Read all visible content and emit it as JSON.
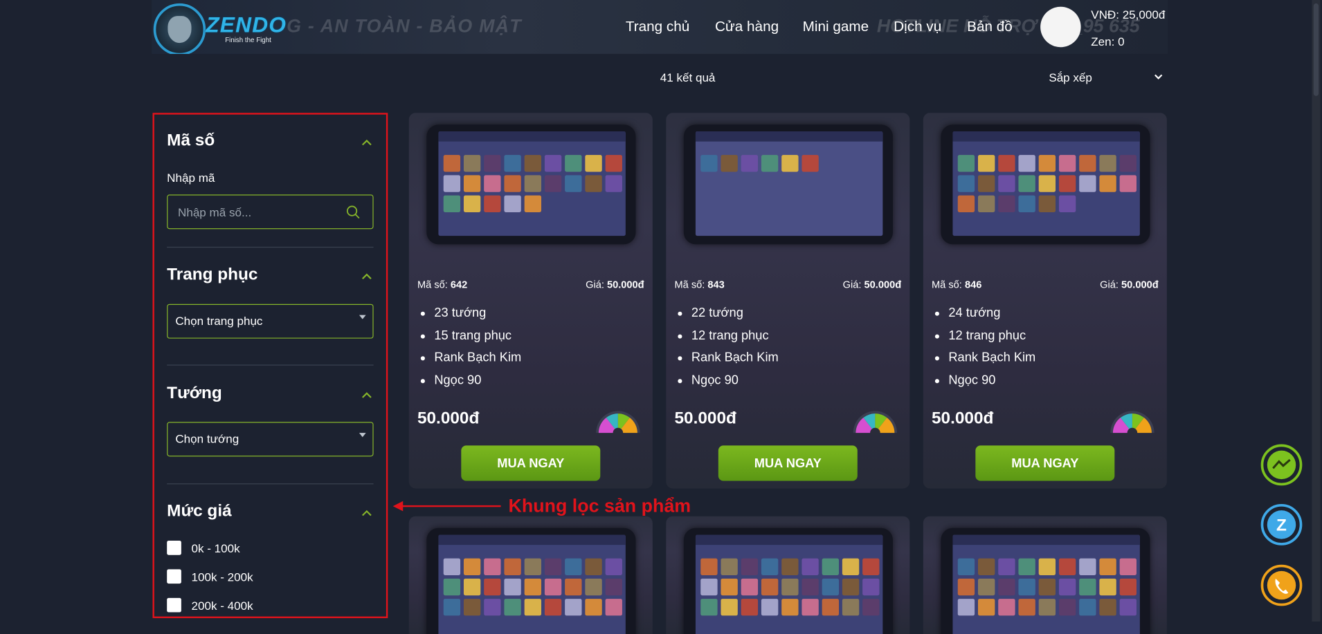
{
  "header": {
    "logo_text": "ZENDO",
    "logo_sub": "Finish the Fight",
    "banner_text": "G - AN TOÀN - BẢO MẬT",
    "banner_text2": "HOTLINE HỖ TRỢ 03__95 635",
    "nav": [
      "Trang chủ",
      "Cửa hàng",
      "Mini game",
      "Dịch vụ",
      "Bản đồ"
    ],
    "balance": "VNĐ: 25,000đ",
    "zen": "Zen: 0"
  },
  "toolbar": {
    "result_count": "41 kết quả",
    "sort_label": "Sắp xếp"
  },
  "sidebar": {
    "code_title": "Mã số",
    "code_label": "Nhập mã",
    "code_placeholder": "Nhập mã số...",
    "outfit_title": "Trang phục",
    "outfit_select": "Chọn trang phục",
    "hero_title": "Tướng",
    "hero_select": "Chọn tướng",
    "price_title": "Mức giá",
    "price_ranges": [
      "0k - 100k",
      "100k - 200k",
      "200k - 400k"
    ]
  },
  "annotation": {
    "text": "Khung lọc sản phẩm",
    "color": "#e0131b"
  },
  "cards": [
    {
      "code_label": "Mã số:",
      "code": "642",
      "price_label": "Giá:",
      "price_small": "50.000đ",
      "features": [
        "23 tướng",
        "15 trang phục",
        "Rank Bạch Kim",
        "Ngọc 90"
      ],
      "price_big": "50.000đ",
      "buy_label": "MUA NGAY"
    },
    {
      "code_label": "Mã số:",
      "code": "843",
      "price_label": "Giá:",
      "price_small": "50.000đ",
      "features": [
        "22 tướng",
        "12 trang phục",
        "Rank Bạch Kim",
        "Ngọc 90"
      ],
      "price_big": "50.000đ",
      "buy_label": "MUA NGAY"
    },
    {
      "code_label": "Mã số:",
      "code": "846",
      "price_label": "Giá:",
      "price_small": "50.000đ",
      "features": [
        "24 tướng",
        "12 trang phục",
        "Rank Bạch Kim",
        "Ngọc 90"
      ],
      "price_big": "50.000đ",
      "buy_label": "MUA NGAY"
    }
  ],
  "float_buttons": [
    "messenger-icon",
    "zalo-icon",
    "phone-icon"
  ],
  "colors": {
    "accent_green": "#7cb81f",
    "background": "#1c2230",
    "highlight_red": "#e0131b"
  }
}
